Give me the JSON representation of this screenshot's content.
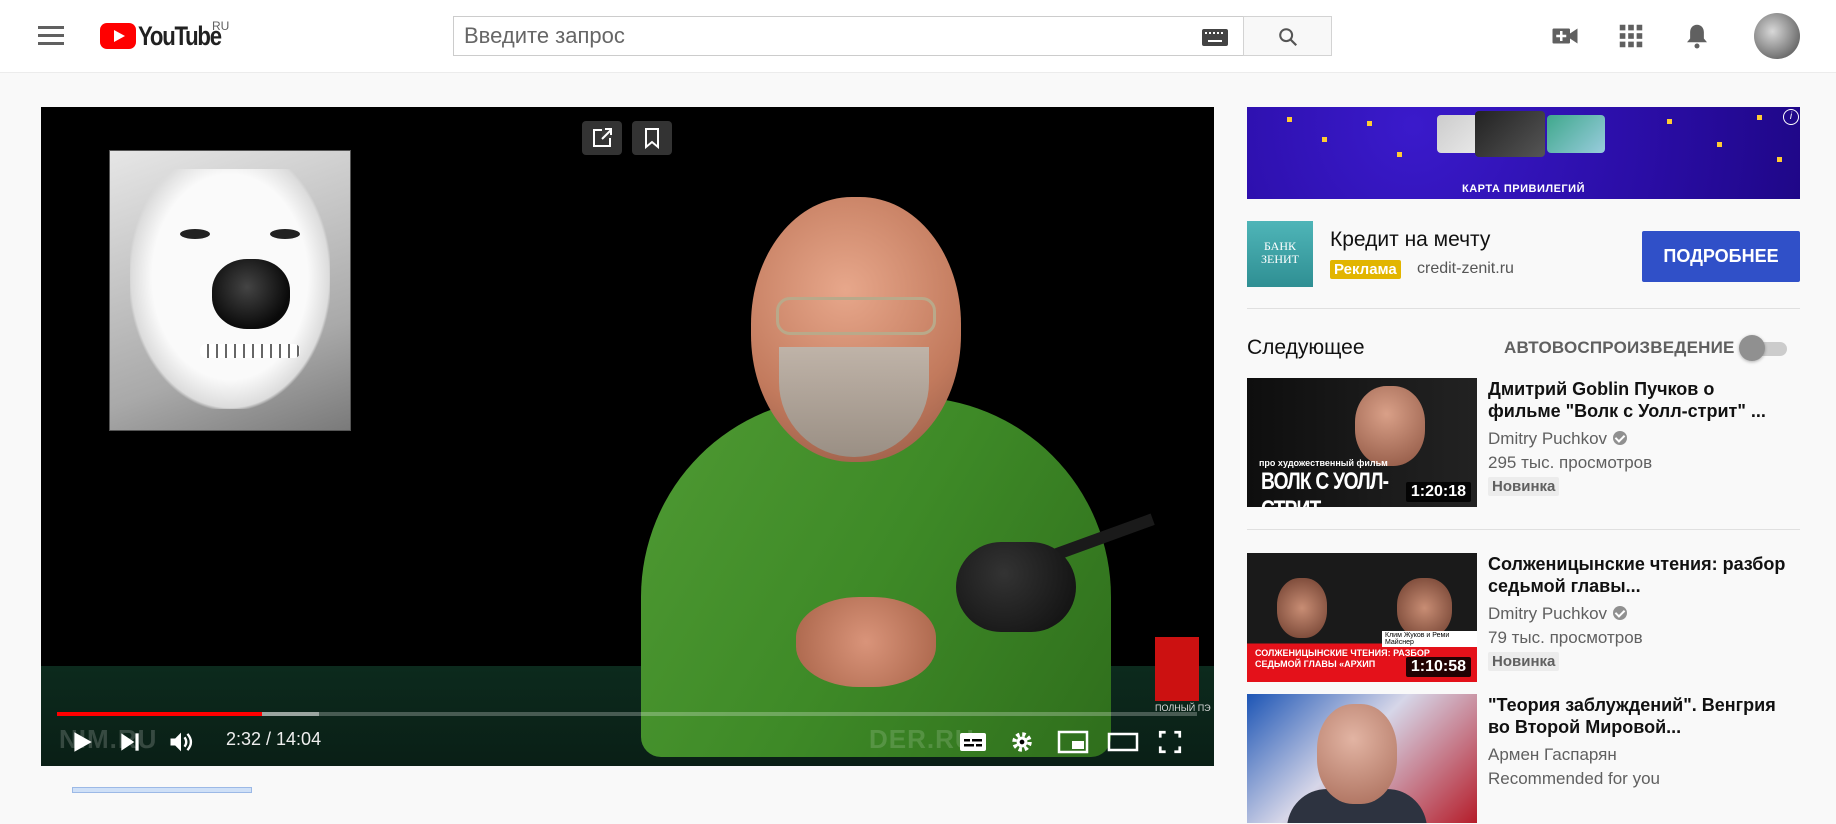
{
  "header": {
    "logo_text": "YouTube",
    "logo_region": "RU",
    "search_placeholder": "Введите запрос"
  },
  "player": {
    "time_display": "2:32 / 14:04",
    "progress_played_percent": 18,
    "progress_loaded_percent": 23,
    "watermark_left": "NIM.RU",
    "watermark_right": "DER.RU",
    "channel_watermark_text": "ПОЛНЫЙ ПЭ"
  },
  "ad": {
    "banner_text": "КАРТА ПРИВИЛЕГИЙ",
    "logo_text": "БАНК ЗЕНИТ",
    "title": "Кредит на мечту",
    "badge": "Реклама",
    "domain": "credit-zenit.ru",
    "cta": "ПОДРОБНЕЕ",
    "info_icon": "i"
  },
  "up_next": {
    "heading": "Следующее",
    "autoplay_label": "АВТОВОСПРОИЗВЕДЕНИЕ",
    "autoplay_on": false
  },
  "recommendations": [
    {
      "title": "Дмитрий Goblin Пучков о фильме \"Волк с Уолл-стрит\" ...",
      "channel": "Dmitry Puchkov",
      "verified": true,
      "views": "295 тыс. просмотров",
      "badge": "Новинка",
      "duration": "1:20:18",
      "thumb_text_small": "про художественный фильм",
      "thumb_text_large": "ВОЛК С УОЛЛ-СТРИТ"
    },
    {
      "title": "Солженицынские чтения: разбор седьмой главы...",
      "channel": "Dmitry Puchkov",
      "verified": true,
      "views": "79 тыс. просмотров",
      "badge": "Новинка",
      "duration": "1:10:58",
      "thumb_label": "Клим Жуков и Реми Майснер",
      "thumb_text": "СОЛЖЕНИЦЫНСКИЕ ЧТЕНИЯ: РАЗБОР СЕДЬМОЙ ГЛАВЫ «АРХИП"
    },
    {
      "title": "\"Теория заблуждений\". Венгрия во Второй Мировой...",
      "channel": "Армен Гаспарян",
      "verified": false,
      "views": "Recommended for you"
    }
  ],
  "colors": {
    "brand_red": "#ff0000",
    "cta_blue": "#3050c8",
    "ad_badge_yellow": "#e2b500"
  }
}
